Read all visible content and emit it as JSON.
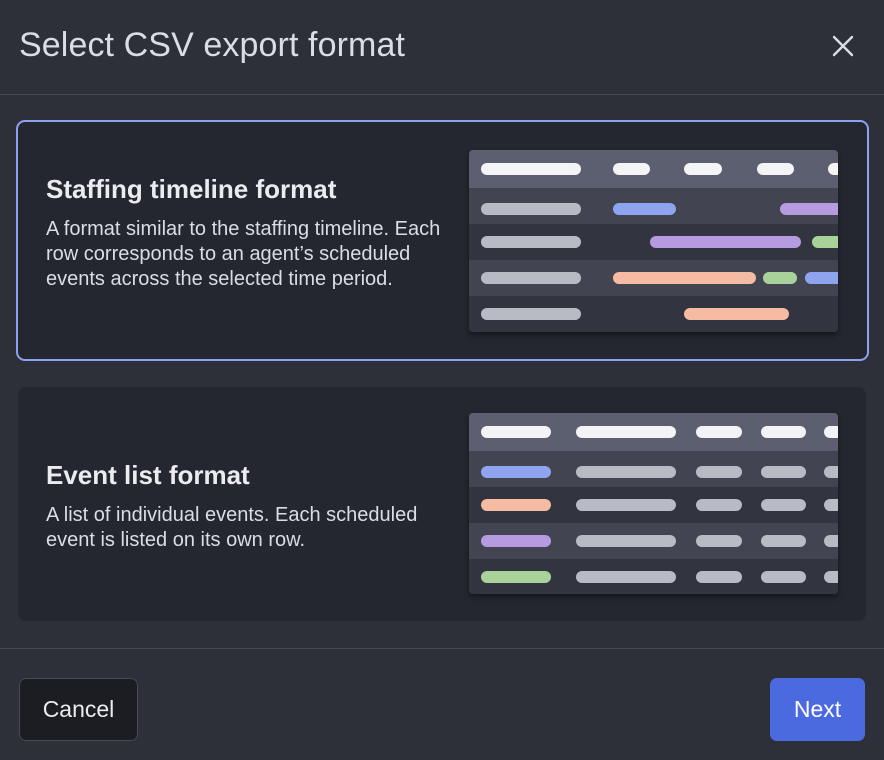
{
  "dialog": {
    "title": "Select CSV export format",
    "close_icon": "close-icon"
  },
  "options": [
    {
      "id": "timeline",
      "title": "Staffing timeline format",
      "description": "A format similar to the staffing timeline. Each row corresponds to an agent’s scheduled events across the selected time period.",
      "selected": true
    },
    {
      "id": "events",
      "title": "Event list format",
      "description": "A list of individual events. Each scheduled event is listed on its own row.",
      "selected": false
    }
  ],
  "footer": {
    "cancel_label": "Cancel",
    "next_label": "Next"
  },
  "colors": {
    "accent": "#4c6ae0",
    "selected_border": "#8ea0f0",
    "event_blue": "#8fa4ee",
    "event_purple": "#b79be0",
    "event_green": "#a9d29a",
    "event_peach": "#f5bba3"
  }
}
